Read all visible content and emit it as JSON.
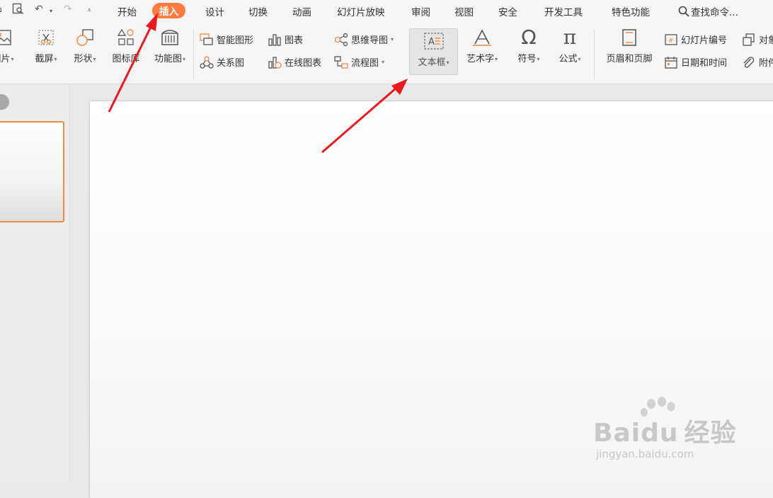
{
  "menu": {
    "tabs": [
      "开始",
      "插入",
      "设计",
      "切换",
      "动画",
      "幻灯片放映",
      "审阅",
      "视图",
      "安全",
      "开发工具",
      "特色功能"
    ],
    "active_tab": "插入",
    "search_label": "查找命令..."
  },
  "ribbon": {
    "picture": "图片",
    "screenshot": "截屏",
    "shapes": "形状",
    "icon_library": "图标库",
    "function_chart": "功能图",
    "smart_shape": "智能图形",
    "chart": "图表",
    "relation_chart": "关系图",
    "online_chart": "在线图表",
    "mind_map": "思维导图",
    "flowchart": "流程图",
    "textbox": "文本框",
    "art_text": "艺术字",
    "symbol": "符号",
    "formula": "公式",
    "header_footer": "页眉和页脚",
    "slide_number": "幻灯片编号",
    "object": "对象",
    "date_time": "日期和时间",
    "attachment": "附件"
  },
  "watermark": {
    "brand": "Baidu",
    "brand_cn": "经验",
    "url": "jingyan.baidu.com"
  },
  "colors": {
    "accent": "#ff7a3d",
    "arrow": "#e8191f"
  }
}
